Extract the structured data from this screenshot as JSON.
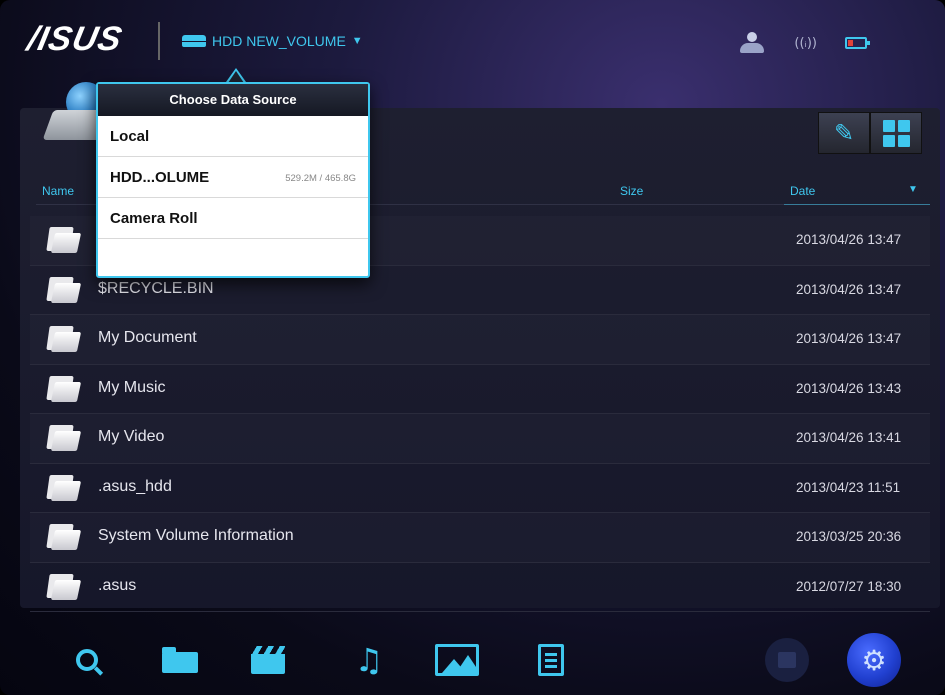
{
  "header": {
    "logo": "/ISUS",
    "source_label": "HDD NEW_VOLUME",
    "source_caret": "▼",
    "wifi_glyph": "((ᵢ))"
  },
  "columns": {
    "name": "Name",
    "size": "Size",
    "date": "Date",
    "sort_caret": "▼"
  },
  "files": [
    {
      "name": "",
      "date": "2013/04/26 13:47"
    },
    {
      "name": "$RECYCLE.BIN",
      "date": "2013/04/26 13:47"
    },
    {
      "name": "My Document",
      "date": "2013/04/26 13:47"
    },
    {
      "name": "My Music",
      "date": "2013/04/26 13:43"
    },
    {
      "name": "My Video",
      "date": "2013/04/26 13:41"
    },
    {
      "name": ".asus_hdd",
      "date": "2013/04/23 11:51"
    },
    {
      "name": "System Volume Information",
      "date": "2013/03/25 20:36"
    },
    {
      "name": ".asus",
      "date": "2012/07/27 18:30"
    }
  ],
  "popover": {
    "title": "Choose Data Source",
    "items": [
      {
        "label": "Local",
        "sub": ""
      },
      {
        "label": "HDD...OLUME",
        "sub": "529.2M / 465.8G"
      },
      {
        "label": "Camera Roll",
        "sub": ""
      }
    ]
  },
  "toolbar": {
    "music_glyph": "♫",
    "gear_glyph": "⚙"
  },
  "icons": [
    "hdd-icon",
    "user-icon",
    "wifi-icon",
    "battery-icon",
    "pencil-icon",
    "grid-icon",
    "folder-icon",
    "search-icon",
    "folder-icon",
    "clapperboard-icon",
    "music-icon",
    "photo-icon",
    "document-icon",
    "home-icon",
    "gear-icon"
  ],
  "colors": {
    "accent": "#3fc7ee",
    "battery_low": "#e0443a",
    "gear_blue": "#2140d0"
  }
}
